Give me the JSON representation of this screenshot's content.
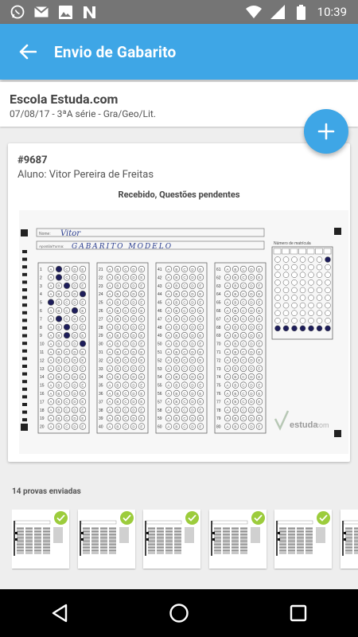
{
  "status_bar": {
    "time": "10:39",
    "left_icons": [
      "whatsapp-icon",
      "gmail-icon",
      "image-icon",
      "n-app-icon"
    ],
    "right_icons": [
      "wifi-icon",
      "signal-icon",
      "battery-icon"
    ]
  },
  "app_bar": {
    "title": "Envio de Gabarito",
    "back_icon": "arrow-back-icon",
    "color": "#3ea6e6"
  },
  "school": {
    "name": "Escola Estuda.com",
    "meta": "07/08/17 - 3ªA série - Gra/Geo/Lit."
  },
  "fab": {
    "icon": "plus-icon",
    "color": "#3ea6e6"
  },
  "sheet": {
    "id": "#9687",
    "student": "Aluno: Vitor Pereira de Freitas",
    "status": "Recebido, Questões pendentes",
    "image": {
      "name_label": "Nome:",
      "name_value": "Vitor",
      "subject_label": "Apostila/Turma:",
      "subject_value": "GABARITO MODELO",
      "matricula_label": "Número de matrícula",
      "brand": "estuda",
      "brand_suffix": ".com",
      "options": [
        "A",
        "B",
        "C",
        "D",
        "E"
      ],
      "question_start": 1,
      "questions_per_column": 20,
      "column_count": 4,
      "marked_answers": [
        {
          "q": 1,
          "opt": "B"
        },
        {
          "q": 2,
          "opt": "B"
        },
        {
          "q": 3,
          "opt": "C"
        },
        {
          "q": 4,
          "opt": "E"
        },
        {
          "q": 5,
          "opt": "A"
        },
        {
          "q": 6,
          "opt": "D"
        },
        {
          "q": 7,
          "opt": "B"
        },
        {
          "q": 8,
          "opt": "C"
        },
        {
          "q": 9,
          "opt": "C"
        },
        {
          "q": 10,
          "opt": "E"
        }
      ]
    }
  },
  "sent": {
    "label": "14 provas enviadas",
    "thumbnails": [
      "thumb-1",
      "thumb-2",
      "thumb-3",
      "thumb-4",
      "thumb-5",
      "thumb-6"
    ],
    "check_color": "#9ccc3c"
  },
  "nav_bar": {
    "buttons": [
      "back-triangle-icon",
      "home-circle-icon",
      "recents-square-icon"
    ]
  }
}
